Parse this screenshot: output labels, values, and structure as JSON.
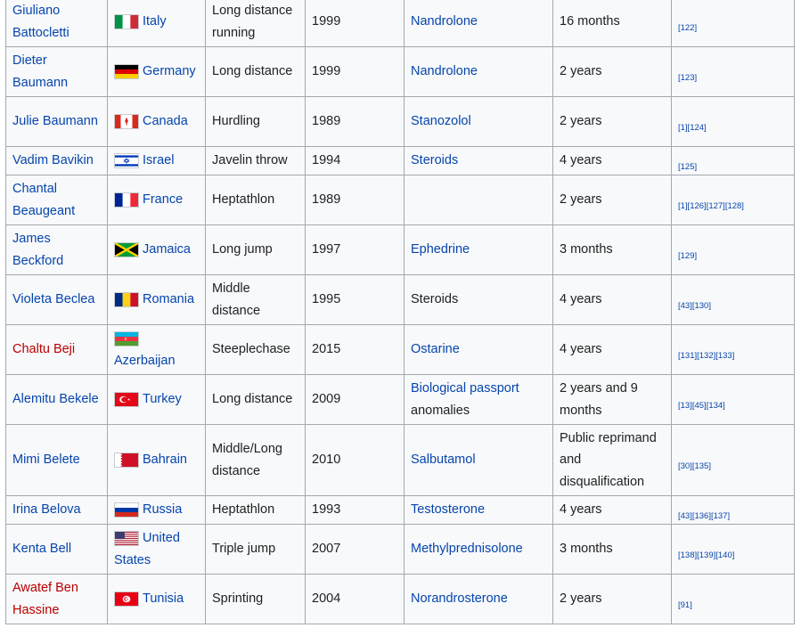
{
  "rows": [
    {
      "name": "Giuliano Battocletti",
      "name_new": false,
      "flag": "italy-flag-icon",
      "country": "Italy",
      "event": "Long distance running",
      "year": "1999",
      "substance": "Nandrolone",
      "substance_link": true,
      "penalty": "16 months",
      "refs": "[122]",
      "height": 56
    },
    {
      "name": "Dieter Baumann",
      "name_new": false,
      "flag": "germany-flag-icon",
      "country": "Germany",
      "event": "Long distance",
      "year": "1999",
      "substance": "Nandrolone",
      "substance_link": true,
      "penalty": "2 years",
      "refs": "[123]",
      "height": 56
    },
    {
      "name": "Julie Baumann",
      "name_new": false,
      "flag": "canada-flag-icon",
      "country": "Canada",
      "event": "Hurdling",
      "year": "1989",
      "substance": "Stanozolol",
      "substance_link": true,
      "penalty": "2 years",
      "refs": "[1][124]",
      "height": 56
    },
    {
      "name": "Vadim Bavikin",
      "name_new": false,
      "flag": "israel-flag-icon",
      "country": "Israel",
      "event": "Javelin throw",
      "year": "1994",
      "substance": "Steroids",
      "substance_link": true,
      "penalty": "4 years",
      "refs": "[125]",
      "height": 32
    },
    {
      "name": "Chantal Beaugeant",
      "name_new": false,
      "flag": "france-flag-icon",
      "country": "France",
      "event": "Heptathlon",
      "year": "1989",
      "substance": "",
      "substance_link": false,
      "penalty": "2 years",
      "refs": "[1][126][127][128]",
      "height": 56
    },
    {
      "name": "James Beckford",
      "name_new": false,
      "flag": "jamaica-flag-icon",
      "country": "Jamaica",
      "event": "Long jump",
      "year": "1997",
      "substance": "Ephedrine",
      "substance_link": true,
      "penalty": "3 months",
      "refs": "[129]",
      "height": 56
    },
    {
      "name": "Violeta Beclea",
      "name_new": false,
      "flag": "romania-flag-icon",
      "country": "Romania",
      "event": "Middle distance",
      "year": "1995",
      "substance": "Steroids",
      "substance_link": false,
      "penalty": "4 years",
      "refs": "[43][130]",
      "height": 56
    },
    {
      "name": "Chaltu Beji",
      "name_new": true,
      "flag": "azerbaijan-flag-icon",
      "country": "Azerbaijan",
      "event": "Steeplechase",
      "year": "2015",
      "substance": "Ostarine",
      "substance_link": true,
      "penalty": "4 years",
      "refs": "[131][132][133]",
      "height": 56
    },
    {
      "name": "Alemitu Bekele",
      "name_new": false,
      "flag": "turkey-flag-icon",
      "country": "Turkey",
      "event": "Long distance",
      "year": "2009",
      "substance": "Biological passport",
      "substance_suffix": "anomalies",
      "substance_link": true,
      "penalty": "2 years and 9 months",
      "refs": "[13][45][134]",
      "height": 56
    },
    {
      "name": "Mimi Belete",
      "name_new": false,
      "flag": "bahrain-flag-icon",
      "country": "Bahrain",
      "event": "Middle/Long distance",
      "year": "2010",
      "substance": "Salbutamol",
      "substance_link": true,
      "penalty": "Public reprimand and disqualification",
      "refs": "[30][135]",
      "height": 80
    },
    {
      "name": "Irina Belova",
      "name_new": false,
      "flag": "russia-flag-icon",
      "country": "Russia",
      "event": "Heptathlon",
      "year": "1993",
      "substance": "Testosterone",
      "substance_link": true,
      "penalty": "4 years",
      "refs": "[43][136][137]",
      "height": 32
    },
    {
      "name": "Kenta Bell",
      "name_new": false,
      "flag": "usa-flag-icon",
      "country": "United States",
      "event": "Triple jump",
      "year": "2007",
      "substance": "Methylprednisolone",
      "substance_link": true,
      "penalty": "3 months",
      "refs": "[138][139][140]",
      "height": 56
    },
    {
      "name": "Awatef Ben Hassine",
      "name_new": true,
      "flag": "tunisia-flag-icon",
      "country": "Tunisia",
      "event": "Sprinting",
      "year": "2004",
      "substance": "Norandrosterone",
      "substance_link": true,
      "penalty": "2 years",
      "refs": "[91]",
      "height": 56
    }
  ]
}
